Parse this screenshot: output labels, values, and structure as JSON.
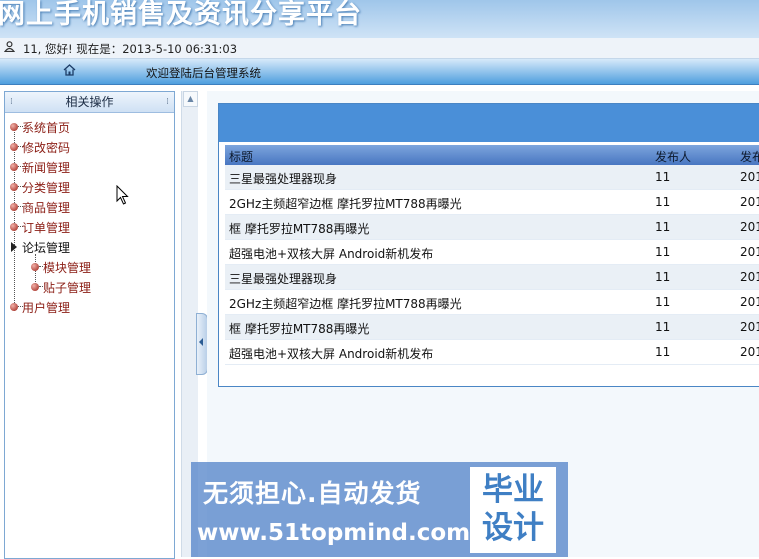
{
  "header": {
    "title": "网上手机销售及资讯分享平台"
  },
  "userbar": {
    "icon": "user-icon",
    "text": "11, 您好! 现在是：2013-5-10 06:31:03"
  },
  "navbar": {
    "home_icon": "home-icon",
    "welcome": "欢迎登陆后台管理系统"
  },
  "sidebar": {
    "title": "相关操作",
    "items": [
      {
        "label": "系统首页",
        "level": 1
      },
      {
        "label": "修改密码",
        "level": 1
      },
      {
        "label": "新闻管理",
        "level": 1
      },
      {
        "label": "分类管理",
        "level": 1
      },
      {
        "label": "商品管理",
        "level": 1
      },
      {
        "label": "订单管理",
        "level": 1
      },
      {
        "label": "论坛管理",
        "level": 1,
        "expanded": true
      },
      {
        "label": "模块管理",
        "level": 2
      },
      {
        "label": "贴子管理",
        "level": 2
      },
      {
        "label": "用户管理",
        "level": 1
      }
    ]
  },
  "table": {
    "columns": [
      "标题",
      "发布人",
      "发布"
    ],
    "rows": [
      [
        "三星最强处理器现身",
        "11",
        "201"
      ],
      [
        "2GHz主频超窄边框 摩托罗拉MT788再曝光",
        "11",
        "201"
      ],
      [
        "框 摩托罗拉MT788再曝光",
        "11",
        "201"
      ],
      [
        "超强电池+双核大屏 Android新机发布",
        "11",
        "201"
      ],
      [
        "三星最强处理器现身",
        "11",
        "201"
      ],
      [
        "2GHz主频超窄边框 摩托罗拉MT788再曝光",
        "11",
        "201"
      ],
      [
        "框 摩托罗拉MT788再曝光",
        "11",
        "201"
      ],
      [
        "超强电池+双核大屏 Android新机发布",
        "11",
        "201"
      ]
    ]
  },
  "watermark": {
    "slogan": "无须担心.自动发货",
    "url": "www.51topmind.com",
    "box_line1": "毕业",
    "box_line2": "设计"
  },
  "colors": {
    "nav_blue": "#4a8fd8",
    "tree_text": "#8b1d14"
  }
}
